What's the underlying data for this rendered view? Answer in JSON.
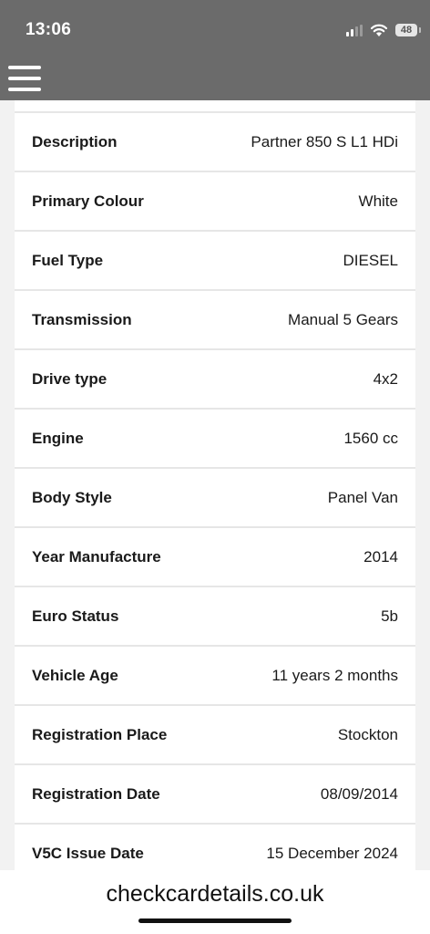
{
  "status_bar": {
    "time": "13:06",
    "battery": "48",
    "icons": [
      "signal-icon",
      "wifi-icon",
      "battery-icon"
    ]
  },
  "header": {
    "menu_icon": "hamburger-menu-icon",
    "background_color": "#6b6b6b"
  },
  "details": [
    {
      "label": "Description",
      "value": "Partner 850 S L1 HDi"
    },
    {
      "label": "Primary Colour",
      "value": "White"
    },
    {
      "label": "Fuel Type",
      "value": "DIESEL"
    },
    {
      "label": "Transmission",
      "value": "Manual 5 Gears"
    },
    {
      "label": "Drive type",
      "value": "4x2"
    },
    {
      "label": "Engine",
      "value": "1560 cc"
    },
    {
      "label": "Body Style",
      "value": "Panel Van"
    },
    {
      "label": "Year Manufacture",
      "value": "2014"
    },
    {
      "label": "Euro Status",
      "value": "5b"
    },
    {
      "label": "Vehicle Age",
      "value": "11 years 2 months"
    },
    {
      "label": "Registration Place",
      "value": "Stockton"
    },
    {
      "label": "Registration Date",
      "value": "08/09/2014"
    },
    {
      "label": "V5C Issue Date",
      "value": "15 December 2024"
    }
  ],
  "browser": {
    "url": "checkcardetails.co.uk"
  }
}
